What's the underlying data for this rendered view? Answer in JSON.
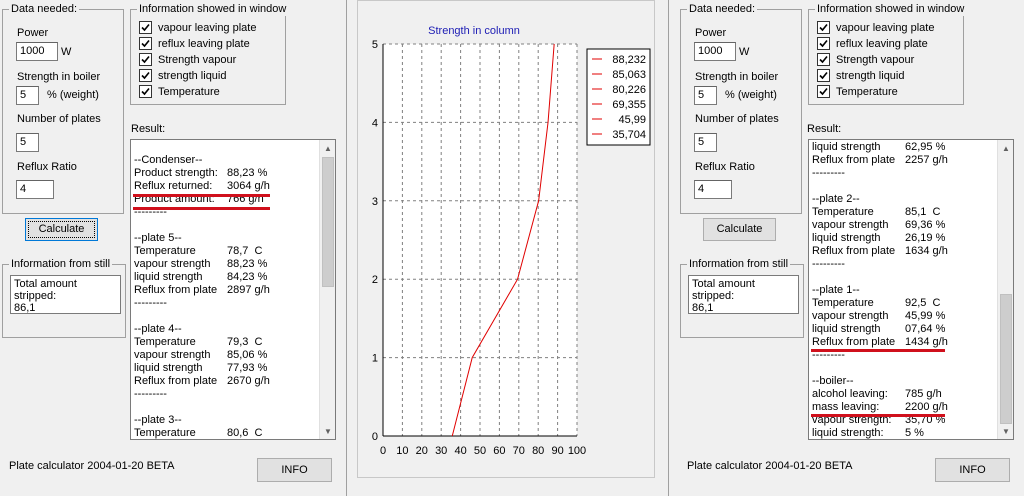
{
  "left": {
    "data_needed": {
      "title": "Data needed:",
      "power_label": "Power",
      "power_value": "1000",
      "power_unit": "W",
      "strength_label": "Strength in  boiler",
      "strength_value": "5",
      "strength_unit": "% (weight)",
      "plates_label": "Number of plates",
      "plates_value": "5",
      "reflux_label": "Reflux Ratio",
      "reflux_value": "4",
      "calculate": "Calculate"
    },
    "info_window": {
      "title": "Information showed in window",
      "items": [
        "vapour leaving plate",
        "reflux leaving plate",
        "Strength vapour",
        "strength liquid",
        "Temperature"
      ]
    },
    "result_label": "Result:",
    "result_lines": [
      {
        "k": "",
        "v": ""
      },
      {
        "k": "--Condenser--",
        "v": ""
      },
      {
        "k": "Product strength:",
        "v": "88,23 %"
      },
      {
        "k": "Reflux returned:",
        "v": "3064 g/h"
      },
      {
        "k": "Product amount:",
        "v": "766 g/h"
      },
      {
        "k": "---------",
        "v": ""
      },
      {
        "k": "",
        "v": ""
      },
      {
        "k": "--plate 5--",
        "v": ""
      },
      {
        "k": "Temperature",
        "v": "78,7  C"
      },
      {
        "k": "vapour strength",
        "v": "88,23 %"
      },
      {
        "k": "liquid strength",
        "v": "84,23 %"
      },
      {
        "k": "Reflux from plate",
        "v": "2897 g/h"
      },
      {
        "k": "---------",
        "v": ""
      },
      {
        "k": "",
        "v": ""
      },
      {
        "k": "--plate 4--",
        "v": ""
      },
      {
        "k": "Temperature",
        "v": "79,3  C"
      },
      {
        "k": "vapour strength",
        "v": "85,06 %"
      },
      {
        "k": "liquid strength",
        "v": "77,93 %"
      },
      {
        "k": "Reflux from plate",
        "v": "2670 g/h"
      },
      {
        "k": "---------",
        "v": ""
      },
      {
        "k": "",
        "v": ""
      },
      {
        "k": "--plate 3--",
        "v": ""
      },
      {
        "k": "Temperature",
        "v": "80,6  C"
      }
    ],
    "still": {
      "title": "Information from still",
      "line1": "Total amount stripped:",
      "line2": "86,1"
    },
    "footer": "Plate calculator 2004-01-20 BETA",
    "info_button": "INFO"
  },
  "right": {
    "data_needed": {
      "title": "Data needed:",
      "power_label": "Power",
      "power_value": "1000",
      "power_unit": "W",
      "strength_label": "Strength in  boiler",
      "strength_value": "5",
      "strength_unit": "% (weight)",
      "plates_label": "Number of plates",
      "plates_value": "5",
      "reflux_label": "Reflux Ratio",
      "reflux_value": "4",
      "calculate": "Calculate"
    },
    "info_window": {
      "title": "Information showed in window",
      "items": [
        "vapour leaving plate",
        "reflux leaving plate",
        "Strength vapour",
        "strength liquid",
        "Temperature"
      ]
    },
    "result_label": "Result:",
    "result_lines": [
      {
        "k": "liquid strength",
        "v": "62,95 %"
      },
      {
        "k": "Reflux from plate",
        "v": "2257 g/h"
      },
      {
        "k": "---------",
        "v": ""
      },
      {
        "k": "",
        "v": ""
      },
      {
        "k": "--plate 2--",
        "v": ""
      },
      {
        "k": "Temperature",
        "v": "85,1  C"
      },
      {
        "k": "vapour strength",
        "v": "69,36 %"
      },
      {
        "k": "liquid strength",
        "v": "26,19 %"
      },
      {
        "k": "Reflux from plate",
        "v": "1634 g/h"
      },
      {
        "k": "---------",
        "v": ""
      },
      {
        "k": "",
        "v": ""
      },
      {
        "k": "--plate 1--",
        "v": ""
      },
      {
        "k": "Temperature",
        "v": "92,5  C"
      },
      {
        "k": "vapour strength",
        "v": "45,99 %"
      },
      {
        "k": "liquid strength",
        "v": "07,64 %"
      },
      {
        "k": "Reflux from plate",
        "v": "1434 g/h"
      },
      {
        "k": "---------",
        "v": ""
      },
      {
        "k": "",
        "v": ""
      },
      {
        "k": "--boiler--",
        "v": ""
      },
      {
        "k": "alcohol leaving:",
        "v": "785 g/h"
      },
      {
        "k": "mass leaving:",
        "v": "2200 g/h"
      },
      {
        "k": "vapour strength:",
        "v": "35,70 %"
      },
      {
        "k": "liquid strength:",
        "v": "5 %"
      }
    ],
    "still": {
      "title": "Information from still",
      "line1": "Total amount stripped:",
      "line2": "86,1"
    },
    "footer": "Plate calculator 2004-01-20 BETA",
    "info_button": "INFO"
  },
  "colors": {
    "accent": "#0078d7",
    "highlight": "#d0101c",
    "curve": "#e00000",
    "title": "#1c1cb4"
  },
  "chart_data": {
    "type": "line",
    "title": "Strength in column",
    "xlabel": "",
    "ylabel": "",
    "xlim": [
      0,
      100
    ],
    "ylim": [
      0,
      5
    ],
    "xticks": [
      0,
      10,
      20,
      30,
      40,
      50,
      60,
      70,
      80,
      90,
      100
    ],
    "yticks": [
      0,
      1,
      2,
      3,
      4,
      5
    ],
    "grid": true,
    "legend_position": "top-right",
    "legend": [
      "88,232",
      "85,063",
      "80,226",
      "69,355",
      "45,99",
      "35,704"
    ],
    "series": [
      {
        "x": [
          35.7,
          45.99,
          69.355,
          80.226,
          85.063,
          88.232
        ],
        "y": [
          0,
          1,
          2,
          3,
          4,
          5
        ]
      }
    ]
  }
}
